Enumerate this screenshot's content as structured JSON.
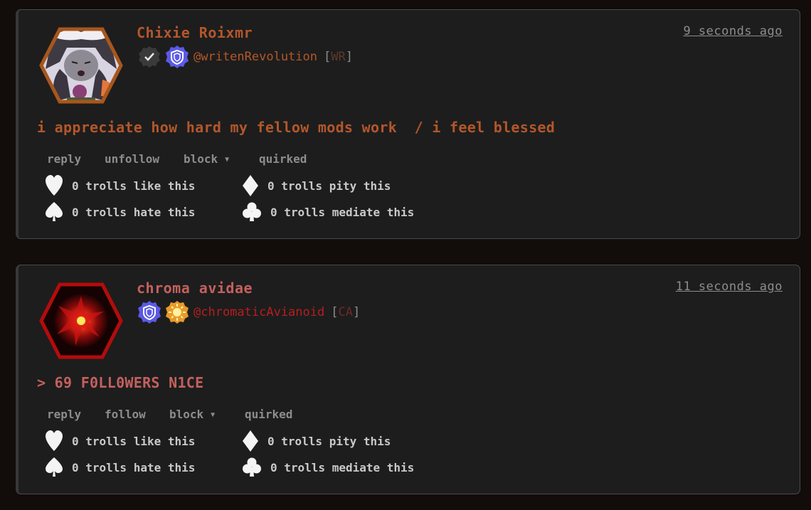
{
  "posts": [
    {
      "name": "Chixie Roixmr",
      "name_color": "#b3572b",
      "handle": "@writenRevolution",
      "handle_color": "#b3572b",
      "tag": "WR",
      "time": "9 seconds ago",
      "message": "i appreciate how hard my fellow mods work  / i feel blessed",
      "message_color": "#b3572b",
      "badges": [
        "checkmark-badge",
        "shield-badge"
      ],
      "actions": {
        "reply": "reply",
        "follow": "unfollow",
        "block": "block",
        "quirked": "quirked"
      },
      "reactions": {
        "like": "0 trolls like this",
        "pity": "0 trolls pity this",
        "hate": "0 trolls hate this",
        "mediate": "0 trolls mediate this"
      }
    },
    {
      "name": "chroma avidae",
      "name_color": "#c4605f",
      "handle": "@chromaticAvianoid",
      "handle_color": "#b81e1e",
      "tag": "CA",
      "time": "11 seconds ago",
      "message": "> 69 F0LL0WERS N1CE",
      "message_color": "#c4605f",
      "badges": [
        "shield-badge",
        "sun-badge"
      ],
      "actions": {
        "reply": "reply",
        "follow": "follow",
        "block": "block",
        "quirked": "quirked"
      },
      "reactions": {
        "like": "0 trolls like this",
        "pity": "0 trolls pity this",
        "hate": "0 trolls hate this",
        "mediate": "0 trolls mediate this"
      }
    }
  ]
}
